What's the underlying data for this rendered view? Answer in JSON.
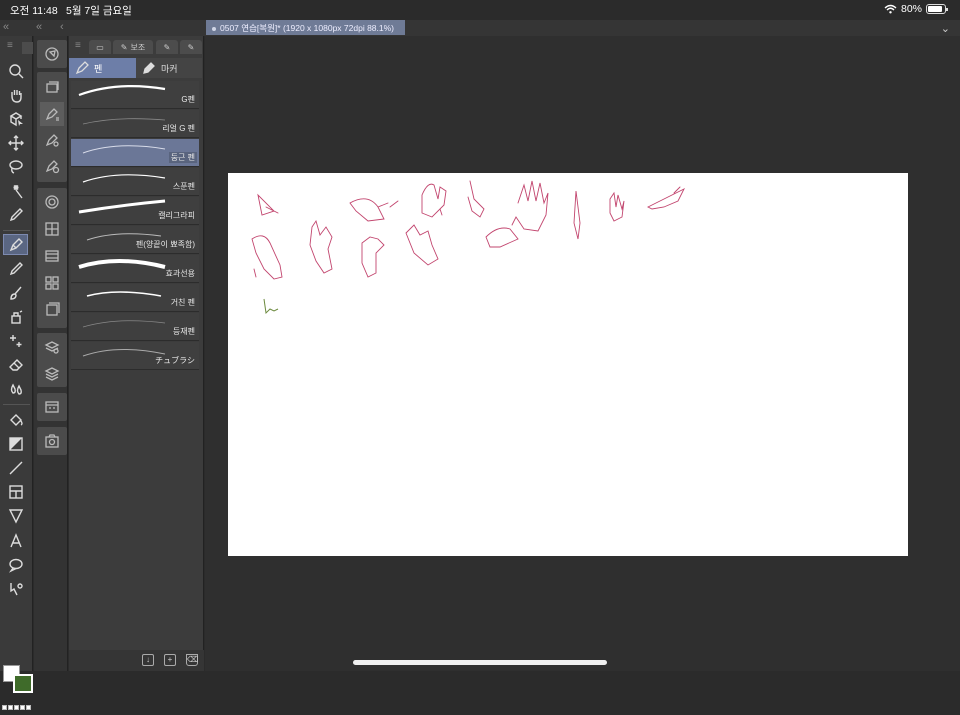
{
  "status_bar": {
    "time": "오전 11:48",
    "date": "5월 7일 금요일",
    "battery": "80%",
    "battery_level": 0.8,
    "wifi_icon": "wifi-icon"
  },
  "document_tab": {
    "title": "0507 연습[복원]* (1920 x 1080px 72dpi 88.1%)"
  },
  "toolbar": {
    "tools": [
      "zoom",
      "hand",
      "object-select",
      "move",
      "lasso",
      "magic-wand",
      "eyedropper",
      "pen",
      "pencil",
      "brush",
      "airbrush",
      "decoration",
      "eraser",
      "blend",
      "fill",
      "gradient",
      "line",
      "frame",
      "ruler",
      "text",
      "balloon",
      "correct-line"
    ],
    "active_tool": "pen",
    "main_color": "#ffffff",
    "sub_color": "#3f6b2a"
  },
  "panel": {
    "top_tabs": [
      "",
      "",
      "보조",
      "",
      ""
    ],
    "sub_tabs": [
      {
        "label": "펜",
        "icon": "pen-icon",
        "active": true
      },
      {
        "label": "마커",
        "icon": "marker-icon",
        "active": false
      }
    ],
    "brushes": [
      {
        "name": "G펜",
        "active": false
      },
      {
        "name": "리얼 G 펜",
        "active": false
      },
      {
        "name": "둥근 펜",
        "active": true
      },
      {
        "name": "스푼펜",
        "active": false
      },
      {
        "name": "캘리그라피",
        "active": false
      },
      {
        "name": "펜(양끝이 뾰족함)",
        "active": false
      },
      {
        "name": "효과선용",
        "active": false
      },
      {
        "name": "거친 펜",
        "active": false
      },
      {
        "name": "등재펜",
        "active": false
      },
      {
        "name": "チュブラシ",
        "active": false
      }
    ]
  },
  "canvas": {
    "background": "#ffffff",
    "sketch_color": "#c2456e"
  }
}
